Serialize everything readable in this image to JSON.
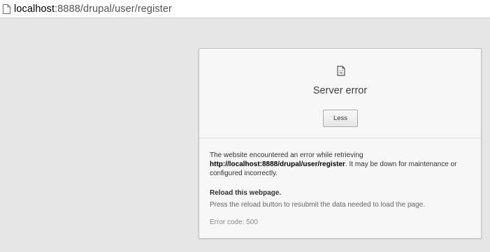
{
  "address_bar": {
    "url_host": "localhost",
    "url_path": ":8888/drupal/user/register",
    "icon": "page-icon"
  },
  "error_card": {
    "icon": "sad-page-icon",
    "title": "Server error",
    "toggle_button_label": "Less",
    "details": {
      "text_before": "The website encountered an error while retrieving ",
      "url": "http://localhost:8888/drupal/user/register",
      "text_after": ". It may be down for maintenance or configured incorrectly.",
      "reload_heading": "Reload this webpage.",
      "reload_desc": "Press the reload button to resubmit the data needed to load the page.",
      "error_code": "Error code: 500"
    }
  },
  "colors": {
    "page_background": "#e6e6e6",
    "card_background": "#f7f7f7"
  }
}
